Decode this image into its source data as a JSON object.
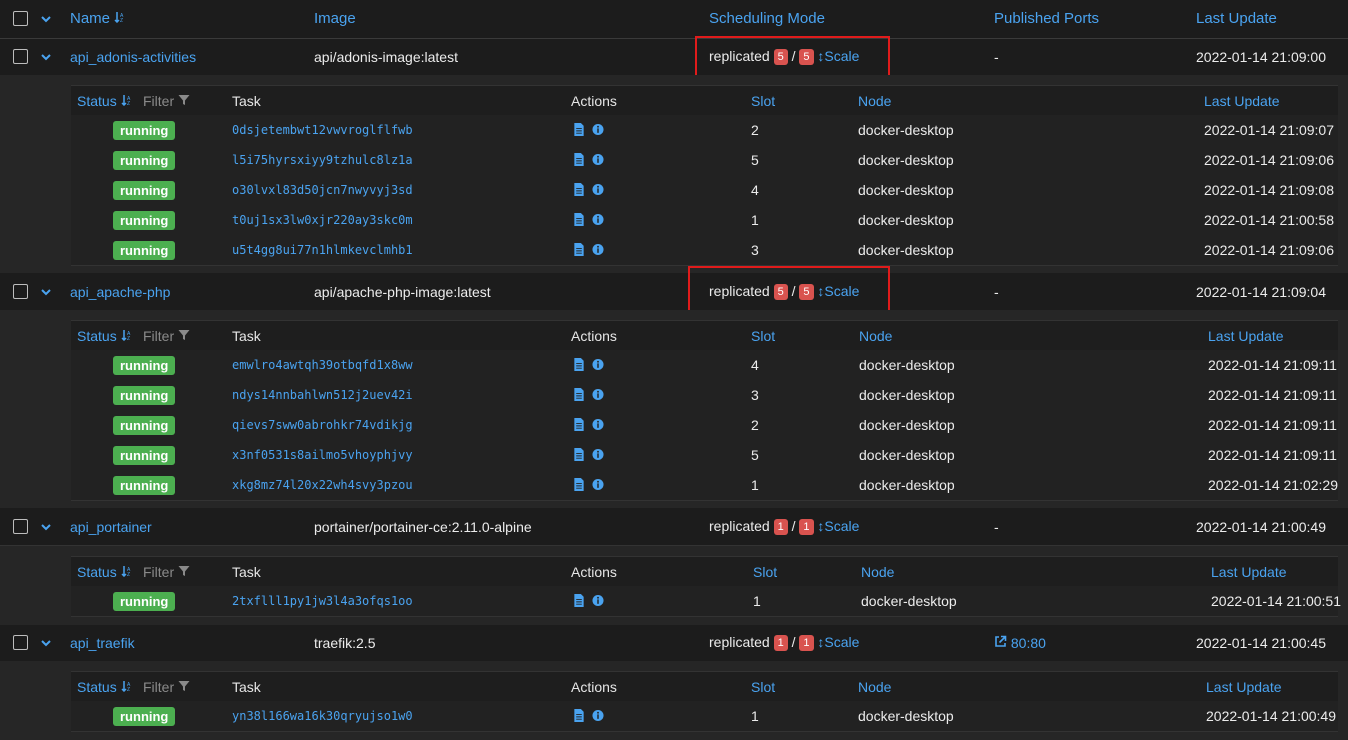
{
  "header": {
    "name": "Name",
    "image": "Image",
    "scheduling_mode": "Scheduling Mode",
    "published_ports": "Published Ports",
    "last_update": "Last Update"
  },
  "task_header": {
    "status": "Status",
    "filter": "Filter",
    "task": "Task",
    "actions": "Actions",
    "slot": "Slot",
    "node": "Node",
    "last_update": "Last Update"
  },
  "labels": {
    "replicated": "replicated",
    "slash": "/",
    "scale": "Scale",
    "running": "running"
  },
  "services": [
    {
      "name": "api_adonis-activities",
      "image": "api/adonis-image:latest",
      "replicas_running": "5",
      "replicas_total": "5",
      "ports": "-",
      "last_update": "2022-01-14 21:09:00",
      "tasks": [
        {
          "id": "0dsjetembwt12vwvroglflfwb",
          "slot": "2",
          "node": "docker-desktop",
          "updated": "2022-01-14 21:09:07"
        },
        {
          "id": "l5i75hyrsxiyy9tzhulc8lz1a",
          "slot": "5",
          "node": "docker-desktop",
          "updated": "2022-01-14 21:09:06"
        },
        {
          "id": "o30lvxl83d50jcn7nwyvyj3sd",
          "slot": "4",
          "node": "docker-desktop",
          "updated": "2022-01-14 21:09:08"
        },
        {
          "id": "t0uj1sx3lw0xjr220ay3skc0m",
          "slot": "1",
          "node": "docker-desktop",
          "updated": "2022-01-14 21:00:58"
        },
        {
          "id": "u5t4gg8ui77n1hlmkevclmhb1",
          "slot": "3",
          "node": "docker-desktop",
          "updated": "2022-01-14 21:09:06"
        }
      ]
    },
    {
      "name": "api_apache-php",
      "image": "api/apache-php-image:latest",
      "replicas_running": "5",
      "replicas_total": "5",
      "ports": "-",
      "last_update": "2022-01-14 21:09:04",
      "tasks": [
        {
          "id": "emwlro4awtqh39otbqfd1x8ww",
          "slot": "4",
          "node": "docker-desktop",
          "updated": "2022-01-14 21:09:11"
        },
        {
          "id": "ndys14nnbahlwn512j2uev42i",
          "slot": "3",
          "node": "docker-desktop",
          "updated": "2022-01-14 21:09:11"
        },
        {
          "id": "qievs7sww0abrohkr74vdikjg",
          "slot": "2",
          "node": "docker-desktop",
          "updated": "2022-01-14 21:09:11"
        },
        {
          "id": "x3nf0531s8ailmo5vhoyphjvy",
          "slot": "5",
          "node": "docker-desktop",
          "updated": "2022-01-14 21:09:11"
        },
        {
          "id": "xkg8mz74l20x22wh4svy3pzou",
          "slot": "1",
          "node": "docker-desktop",
          "updated": "2022-01-14 21:02:29"
        }
      ]
    },
    {
      "name": "api_portainer",
      "image": "portainer/portainer-ce:2.11.0-alpine",
      "replicas_running": "1",
      "replicas_total": "1",
      "ports": "-",
      "last_update": "2022-01-14 21:00:49",
      "tasks": [
        {
          "id": "2txflll1py1jw3l4a3ofqs1oo",
          "slot": "1",
          "node": "docker-desktop",
          "updated": "2022-01-14 21:00:51"
        }
      ]
    },
    {
      "name": "api_traefik",
      "image": "traefik:2.5",
      "replicas_running": "1",
      "replicas_total": "1",
      "ports": "80:80",
      "last_update": "2022-01-14 21:00:45",
      "tasks": [
        {
          "id": "yn38l166wa16k30qryujso1w0",
          "slot": "1",
          "node": "docker-desktop",
          "updated": "2022-01-14 21:00:49"
        }
      ]
    }
  ],
  "colors": {
    "accent": "#4aa3f0",
    "running": "#4caf50",
    "badge": "#d9534f",
    "highlight": "#e01b1b"
  }
}
